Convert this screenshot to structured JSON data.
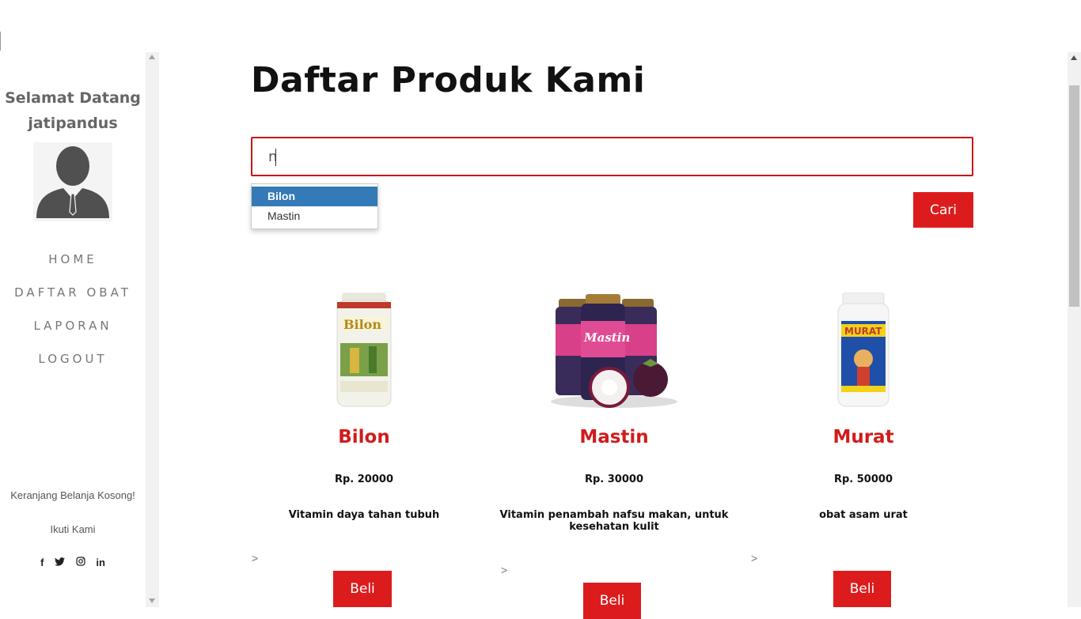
{
  "sidebar": {
    "welcome_line1": "Selamat Datang",
    "welcome_line2": "jatipandus",
    "nav": [
      "HOME",
      "DAFTAR OBAT",
      "LAPORAN",
      "LOGOUT"
    ],
    "cart_text": "Keranjang Belanja Kosong!",
    "follow_text": "Ikuti Kami",
    "social": [
      "f",
      "𝕏",
      "◎",
      "in"
    ]
  },
  "main": {
    "title": "Daftar Produk Kami",
    "search_value": "n",
    "search_button": "Cari",
    "autocomplete": [
      "Bilon",
      "Mastin"
    ],
    "products": [
      {
        "name": "Bilon",
        "price": "Rp. 20000",
        "desc": "Vitamin daya tahan tubuh",
        "button": "Beli"
      },
      {
        "name": "Mastin",
        "price": "Rp. 30000",
        "desc": "Vitamin penambah nafsu makan, untuk kesehatan kulit",
        "button": "Beli"
      },
      {
        "name": "Murat",
        "price": "Rp. 50000",
        "desc": "obat asam urat",
        "button": "Beli"
      }
    ],
    "chevron": ">"
  },
  "colors": {
    "accent": "#dc1c1c",
    "product_name": "#d01c1c",
    "dropdown_highlight": "#337ab7"
  }
}
